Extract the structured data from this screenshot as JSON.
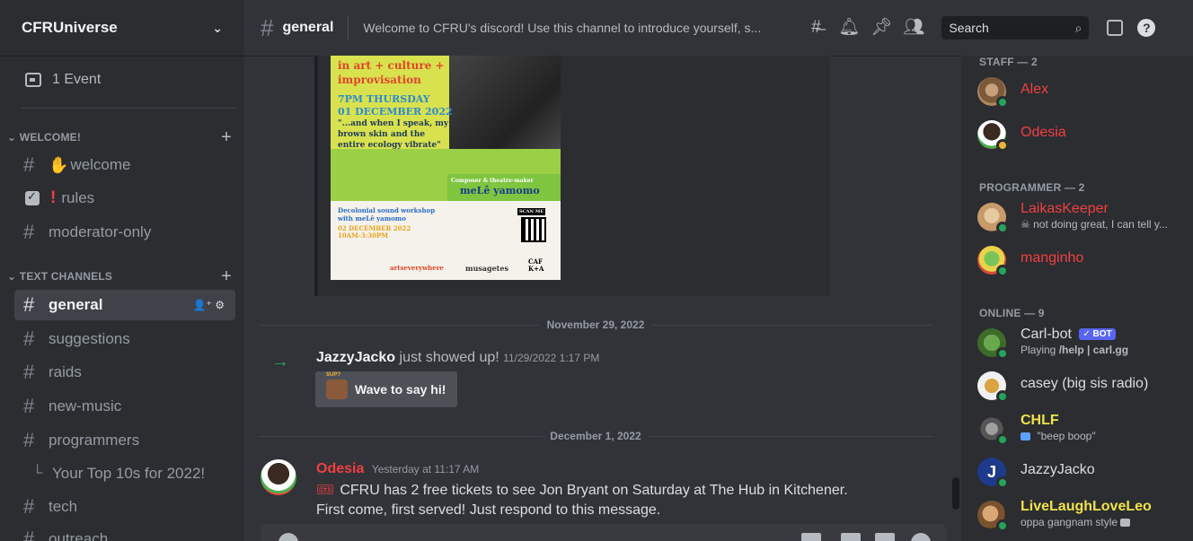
{
  "server": {
    "name": "CFRUniverse",
    "chevron_icon": "chevron-down-icon"
  },
  "event": {
    "label": "1 Event",
    "icon": "calendar-icon"
  },
  "categories": {
    "welcome": "WELCOME!",
    "text_channels": "TEXT CHANNELS"
  },
  "channels": {
    "welcome": "welcome",
    "rules": "rules",
    "moderator_only": "moderator-only",
    "general": "general",
    "suggestions": "suggestions",
    "raids": "raids",
    "new_music": "new-music",
    "programmers": "programmers",
    "thread_top10": "Your Top 10s for 2022!",
    "tech": "tech",
    "outreach": "outreach"
  },
  "topbar": {
    "channel": "general",
    "topic": "Welcome to CFRU's discord! Use this channel to introduce yourself, s..."
  },
  "search": {
    "placeholder": "Search"
  },
  "poster": {
    "line1": "in art + culture +",
    "line2": "improvisation",
    "when1": "7PM THURSDAY",
    "when2": "01 DECEMBER 2022",
    "quote": "\"...and when I speak, my brown skin and the entire ecology vibrate\"",
    "composer": "Composer & theatre-maker",
    "artist": "meLê yamomo",
    "workshop": "Decolonial sound workshop with meLê yamomo",
    "workshop_date": "02 DECEMBER 2022",
    "workshop_time": "10AM-3:30PM",
    "scan": "SCAN ME",
    "sponsor1": "artseverywhere",
    "sponsor2": "musagetes",
    "sponsor3": "CAF K+A"
  },
  "chat": {
    "date1": "November 29, 2022",
    "join_user": "JazzyJacko",
    "join_text": "just showed up!",
    "join_time": "11/29/2022 1:17 PM",
    "wave_label": "Wave to say hi!",
    "date2": "December 1, 2022",
    "msg_author": "Odesia",
    "msg_time": "Yesterday at 11:17 AM",
    "msg_line1": "CFRU has 2 free tickets to see Jon Bryant on Saturday at The Hub in Kitchener.",
    "msg_line2": "First come, first served! Just respond to this message."
  },
  "members": {
    "staff_header": "STAFF — 2",
    "programmer_header": "PROGRAMMER — 2",
    "online_header": "ONLINE — 9",
    "staff": [
      {
        "name": "Alex",
        "color": "#f23f42"
      },
      {
        "name": "Odesia",
        "color": "#f23f42"
      }
    ],
    "programmers": [
      {
        "name": "LaikasKeeper",
        "status": "not doing great, I can tell y...",
        "color": "#f23f42"
      },
      {
        "name": "manginho",
        "color": "#f23f42"
      }
    ],
    "online": [
      {
        "name": "Carl-bot",
        "tag": "✓ BOT",
        "status_prefix": "Playing",
        "status": "/help | carl.gg"
      },
      {
        "name": "casey (big sis radio)"
      },
      {
        "name": "CHLF",
        "status": "\"beep boop\"",
        "color": "#f0e34a"
      },
      {
        "name": "JazzyJacko"
      },
      {
        "name": "LiveLaughLoveLeo",
        "status": "oppa gangnam style",
        "color": "#f0e34a"
      }
    ]
  }
}
